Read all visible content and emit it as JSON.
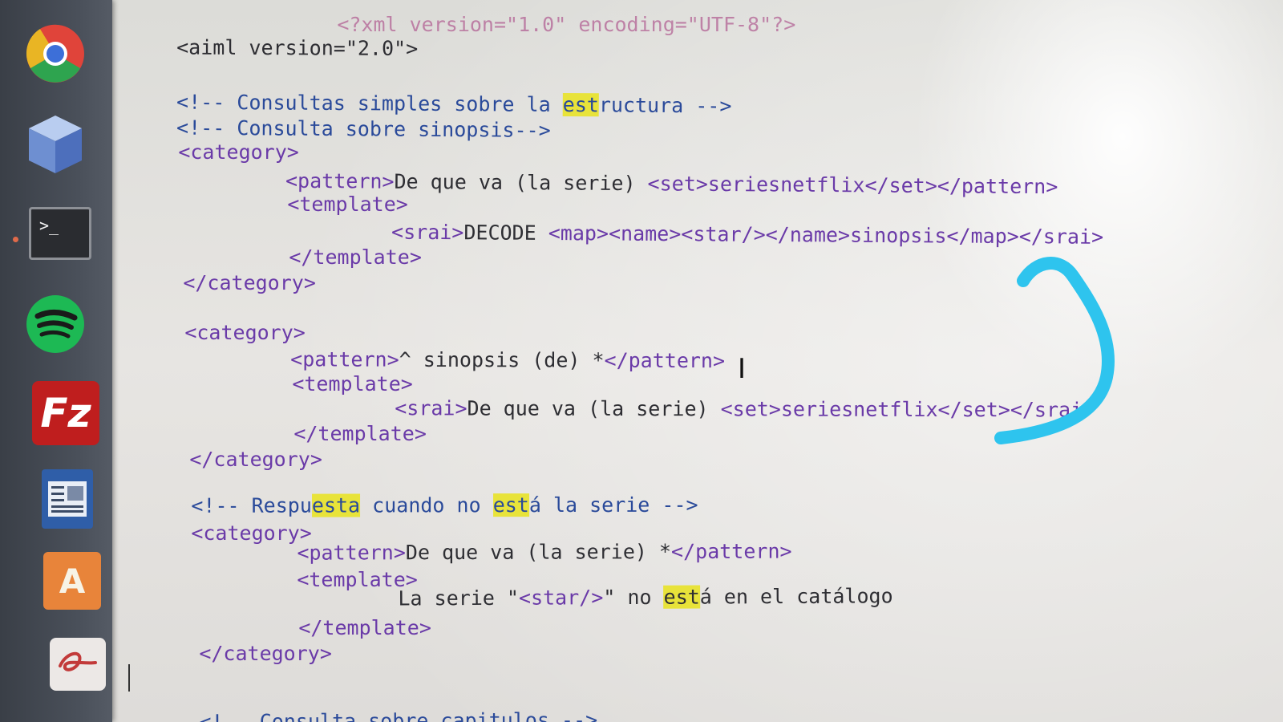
{
  "launcher": {
    "icons": [
      "chrome-icon",
      "cube-icon",
      "terminal-icon",
      "spotify-icon",
      "filezilla-icon",
      "document-viewer-icon",
      "software-center-icon",
      "scribble-app-icon"
    ],
    "filezilla_label": "Fz",
    "terminal_label": ">_",
    "software_center_label": "A"
  },
  "editor": {
    "line_0": "<?xml version=\"1.0\" encoding=\"UTF-8\"?>",
    "line_1": "<aiml version=\"2.0\">",
    "line_2_a": "<!-- Consultas simples sobre la ",
    "line_2_hl": "est",
    "line_2_b": "ructura -->",
    "line_3": "<!-- Consulta sobre sinopsis-->",
    "line_4": "<category>",
    "line_5_tag": "<pattern>",
    "line_5_text": "De que va (la serie) ",
    "line_5_tail": "<set>seriesnetflix</set></pattern>",
    "line_6": "<template>",
    "line_7_tag": "<srai>",
    "line_7_text": "DECODE ",
    "line_7_tail": "<map><name><star/></name>sinopsis</map></srai>",
    "line_8": "</template>",
    "line_9": "</category>",
    "line_10": "<category>",
    "line_11_tag": "<pattern>",
    "line_11_text": "^ sinopsis (de) *",
    "line_11_tail": "</pattern>",
    "line_12": "<template>",
    "line_13_tag": "<srai>",
    "line_13_text": "De que va (la serie) ",
    "line_13_tail": "<set>seriesnetflix</set></srai>",
    "line_14": "</template>",
    "line_15": "</category>",
    "line_16_a": "<!-- Respu",
    "line_16_hl1": "esta",
    "line_16_b": " cuando no ",
    "line_16_hl2": "est",
    "line_16_c": "á la serie -->",
    "line_17": "<category>",
    "line_18_tag": "<pattern>",
    "line_18_text": "De que va (la serie) *",
    "line_18_tail": "</pattern>",
    "line_19": "<template>",
    "line_20_a": "La serie \"",
    "line_20_star": "<star/>",
    "line_20_b": "\" no ",
    "line_20_hl": "est",
    "line_20_c": "á en el catálogo",
    "line_21": "</template>",
    "line_22": "</category>",
    "line_23": "<!-- Consulta sobre capitulos -->"
  },
  "colors": {
    "tag": "#6a3aa8",
    "comment": "#2a4a9a",
    "highlight": "#e8e33a",
    "scribble": "#2ec4ee"
  }
}
